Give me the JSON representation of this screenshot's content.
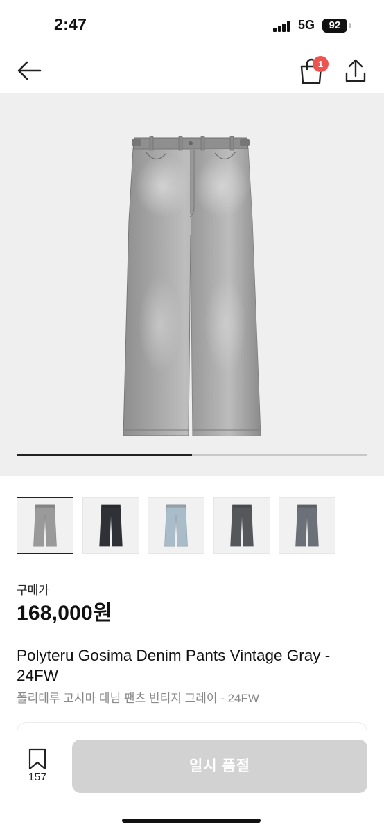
{
  "status_bar": {
    "time": "2:47",
    "network": "5G",
    "battery": "92",
    "icons": [
      "signal-icon",
      "battery-icon"
    ]
  },
  "header": {
    "icons": [
      "back-arrow-icon",
      "shopping-bag-icon",
      "share-icon"
    ],
    "cart_badge": "1",
    "badge_color": "#ef5350"
  },
  "gallery": {
    "main_image": "gray-wide-leg-jeans-image",
    "background_color": "#efefef",
    "progress_fraction": 0.5
  },
  "thumbnails": [
    {
      "name": "vintage-gray-thumb",
      "color": "#9a9a9a",
      "selected": true
    },
    {
      "name": "black-thumb",
      "color": "#2f3136",
      "selected": false
    },
    {
      "name": "light-blue-thumb",
      "color": "#a9bcc9",
      "selected": false
    },
    {
      "name": "charcoal-thumb",
      "color": "#55575a",
      "selected": false
    },
    {
      "name": "gray-blue-thumb",
      "color": "#6c7078",
      "selected": false
    }
  ],
  "price": {
    "label": "구매가",
    "value": "168,000원"
  },
  "product": {
    "name": "Polyteru Gosima Denim Pants Vintage Gray - 24FW",
    "name_ko": "폴리테루 고시마 데님 팬츠 빈티지 그레이 - 24FW"
  },
  "bottom_bar": {
    "bookmark_count": "157",
    "button_label": "일시 품절",
    "button_color": "#d2d2d2"
  }
}
